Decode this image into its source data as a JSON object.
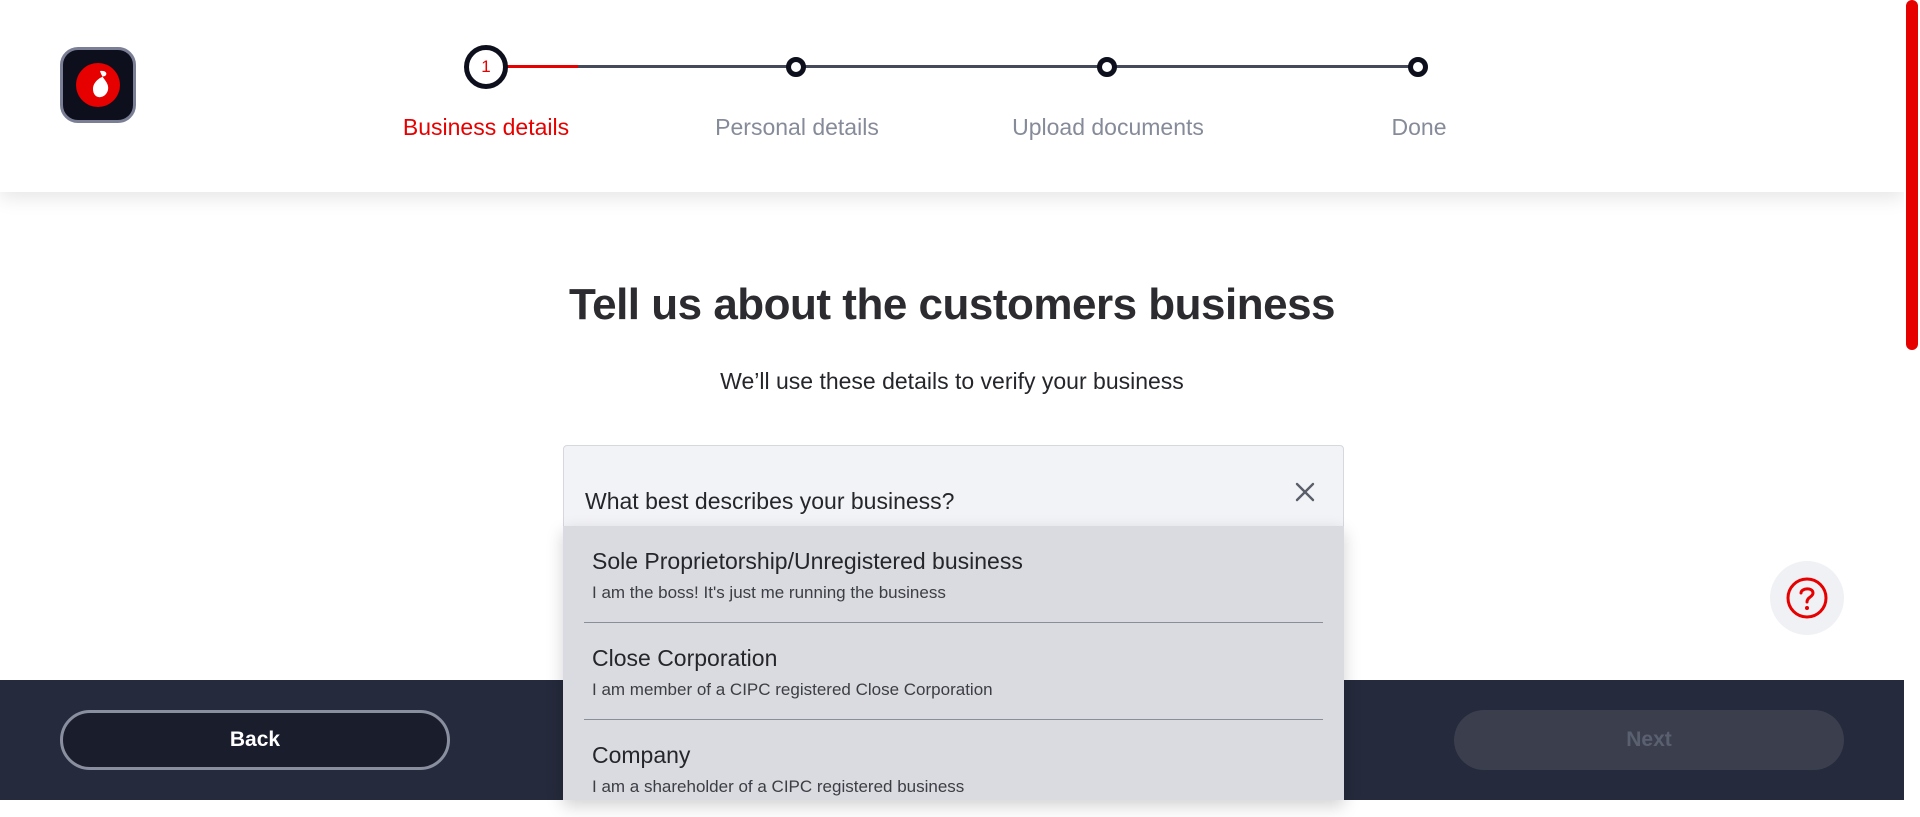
{
  "brand": {
    "accent": "#e60000",
    "dark": "#0e0f1c",
    "logo": "vodafone-logo-icon"
  },
  "stepper": {
    "current_step_number": "1",
    "progress_fraction": 0.1,
    "steps": [
      {
        "label": "Business details",
        "state": "active"
      },
      {
        "label": "Personal details",
        "state": "pending"
      },
      {
        "label": "Upload documents",
        "state": "pending"
      },
      {
        "label": "Done",
        "state": "pending"
      }
    ]
  },
  "main": {
    "title": "Tell us about the customers business",
    "subtitle": "We’ll use these details to verify your business"
  },
  "business_type": {
    "label": "What best describes your business?",
    "close_icon": "close-icon",
    "options": [
      {
        "title": "Sole Proprietorship/Unregistered business",
        "description": "I am the boss! It's just me running the business"
      },
      {
        "title": "Close Corporation",
        "description": "I am member of a CIPC registered Close Corporation"
      },
      {
        "title": "Company",
        "description": "I am a shareholder of a CIPC registered business"
      }
    ]
  },
  "help": {
    "icon": "help-question-icon"
  },
  "footer": {
    "back_label": "Back",
    "next_label": "Next"
  }
}
